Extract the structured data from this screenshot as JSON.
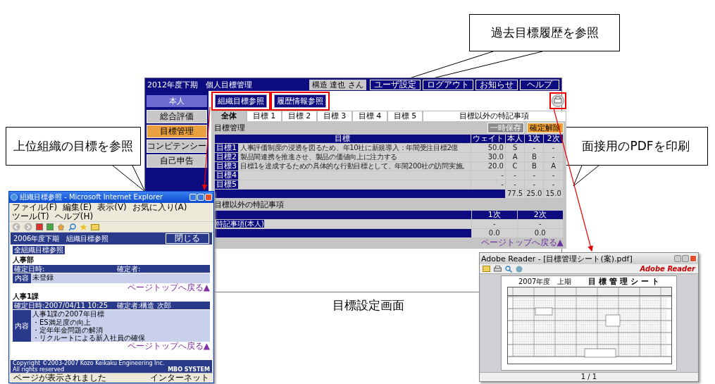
{
  "callouts": [
    {
      "text": "過去目標履歴を参照"
    },
    {
      "text": "上位組織の目標を参照"
    },
    {
      "text": "面接用のPDFを印刷"
    }
  ],
  "caption": "目標設定画面",
  "main_window": {
    "title": "2012年度下期　個人目標管理",
    "user": "構造 達也 さん",
    "header_buttons": [
      "ユーザ設定",
      "ログアウト",
      "お知らせ",
      "ヘルプ"
    ],
    "sidebar": {
      "heading": "本人",
      "items": [
        {
          "label": "総合評価",
          "selected": false
        },
        {
          "label": "目標管理",
          "selected": true
        },
        {
          "label": "コンピテンシー",
          "selected": false
        },
        {
          "label": "自己申告",
          "selected": false
        }
      ]
    },
    "links": [
      {
        "label": "組織目標参照",
        "highlighted": true
      },
      {
        "label": "履歴情報参照",
        "highlighted": true
      }
    ],
    "print_button": {
      "highlighted": true
    },
    "tabs": [
      {
        "label": "全体",
        "selected": true
      },
      {
        "label": "目標 1",
        "selected": false
      },
      {
        "label": "目標 2",
        "selected": false
      },
      {
        "label": "目標 3",
        "selected": false
      },
      {
        "label": "目標 4",
        "selected": false
      },
      {
        "label": "目標 5",
        "selected": false
      },
      {
        "label": "目標以外の特記事項",
        "selected": false
      }
    ],
    "section_title": "目標管理",
    "actions": [
      {
        "label": "一時保存",
        "disabled": true
      },
      {
        "label": "確定解除",
        "disabled": false
      }
    ],
    "goals_table": {
      "columns": [
        "目標",
        "ウェイト",
        "本人",
        "1次",
        "2次"
      ],
      "rows": [
        {
          "label": "目標1",
          "goal": "人事評価制度の浸透を図るため、年10社に新規導入：年間受注目標2億",
          "weight": "50.0",
          "self": "S",
          "first": "-",
          "second": "-"
        },
        {
          "label": "目標2",
          "goal": "製品間連携を推進させ、製品の価値向上に注力する",
          "weight": "30.0",
          "self": "A",
          "first": "B",
          "second": "-"
        },
        {
          "label": "目標3",
          "goal": "目標1を達成するための具体的な行動目標として、年間200社の訪問実施。",
          "weight": "20.0",
          "self": "C",
          "first": "B",
          "second": "A"
        },
        {
          "label": "目標4",
          "weight": "-",
          "self": "-",
          "first": "-",
          "second": "-"
        },
        {
          "label": "目標5",
          "weight": "-",
          "self": "-",
          "first": "-",
          "second": "-"
        }
      ],
      "totals": [
        "77.5",
        "25.0",
        "15.0"
      ]
    },
    "notes_title": "目標以外の特記事項",
    "notes_table": {
      "columns": [
        "1次",
        "2次"
      ],
      "rows": [
        {
          "label": "特記事項(本人)",
          "first": "-",
          "second": "-"
        }
      ],
      "totals": [
        "0.0",
        "0.0"
      ]
    },
    "page_top_link": "ページトップへ戻る▲"
  },
  "browser_window": {
    "title": "組織目標参照 - Microsoft Internet Explorer",
    "menu": [
      "ファイル(F)",
      "編集(E)",
      "表示(V)",
      "お気に入り(A)",
      "ツール(T)",
      "ヘルプ(H)"
    ],
    "header_title": "2006年度下期　組織目標参照",
    "close_button": "閉じる",
    "all_link": "全組織目標参照",
    "sections": [
      {
        "name": "人事部",
        "confirmed_at": "確定日時:",
        "confirmed_by": "確定者:",
        "content_label": "内容",
        "content_lines": [
          "未登録"
        ],
        "page_top": "ページトップへ戻る▲"
      },
      {
        "name": "人事1課",
        "confirmed_at": "確定日時:2007/04/11 10:25",
        "confirmed_by": "確定者:構造 次郎",
        "content_label": "内容",
        "content_lines": [
          "人事1課の2007年目標",
          "・ES満足度の向上",
          "・定年年金問題の解消",
          "・リクルートによる新入社員の確保"
        ],
        "page_top": "ページトップへ戻る▲"
      }
    ],
    "copyright": "Copyright ©2003-2007 Kozo Keikaku Engineering Inc. All rights reserved",
    "logo": "MBO SYSTEM",
    "status": "ページが表示されました",
    "zone": "インターネット"
  },
  "pdf_window": {
    "title": "Adobe Reader - [目標管理シート(案).pdf]",
    "brand": "Adobe Reader",
    "doc_period": "2007年度　上期",
    "doc_title": "目標管理シート",
    "page_indicator": "1 / 1"
  }
}
